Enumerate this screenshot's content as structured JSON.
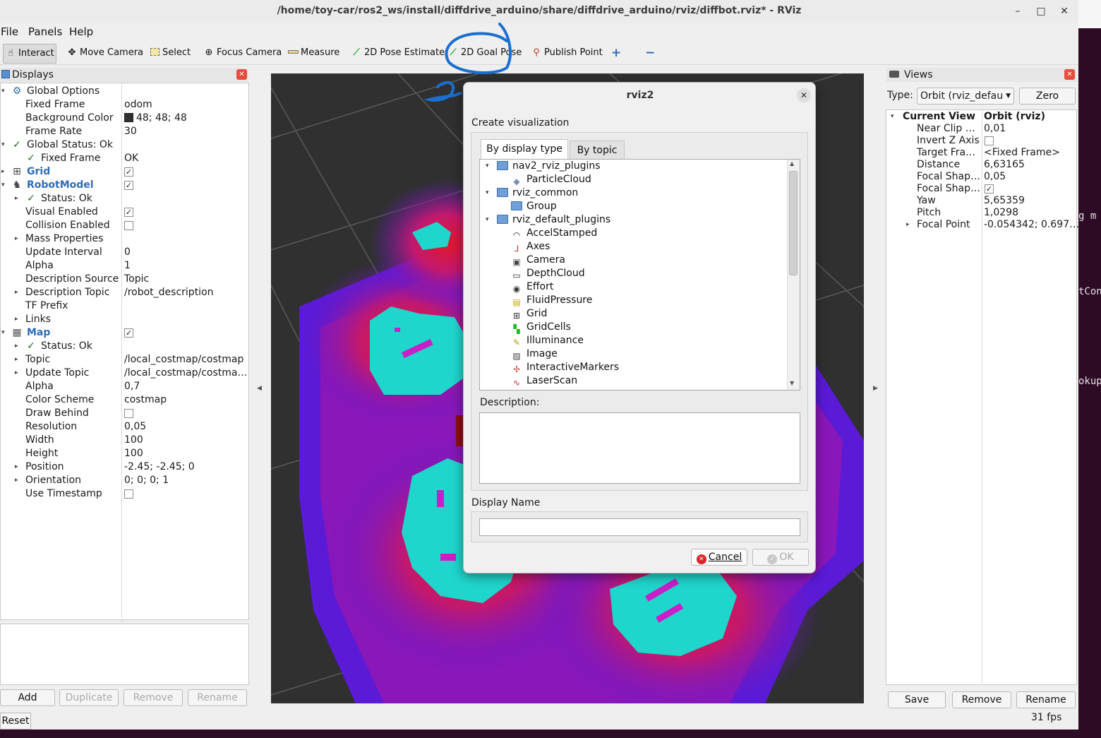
{
  "window": {
    "title": "/home/toy-car/ros2_ws/install/diffdrive_arduino/share/diffdrive_arduino/rviz/diffbot.rviz* - RViz",
    "minimize": "–",
    "maximize": "□",
    "close": "✕"
  },
  "menu": [
    "File",
    "Panels",
    "Help"
  ],
  "toolbar": {
    "interact": "Interact",
    "move_camera": "Move Camera",
    "select": "Select",
    "focus_camera": "Focus Camera",
    "measure": "Measure",
    "pose_estimate": "2D Pose Estimate",
    "goal_pose": "2D Goal Pose",
    "publish_point": "Publish Point",
    "add": "+",
    "remove": "−"
  },
  "displays": {
    "title": "Displays",
    "rows": [
      {
        "label": "Global Options",
        "value": ""
      },
      {
        "label": "Fixed Frame",
        "value": "odom"
      },
      {
        "label": "Background Color",
        "value": "48; 48; 48"
      },
      {
        "label": "Frame Rate",
        "value": "30"
      },
      {
        "label": "Global Status: Ok",
        "value": ""
      },
      {
        "label": "Fixed Frame",
        "value": "OK"
      },
      {
        "label": "Grid",
        "value": ""
      },
      {
        "label": "RobotModel",
        "value": ""
      },
      {
        "label": "Status: Ok",
        "value": ""
      },
      {
        "label": "Visual Enabled",
        "value": ""
      },
      {
        "label": "Collision Enabled",
        "value": ""
      },
      {
        "label": "Mass Properties",
        "value": ""
      },
      {
        "label": "Update Interval",
        "value": "0"
      },
      {
        "label": "Alpha",
        "value": "1"
      },
      {
        "label": "Description Source",
        "value": "Topic"
      },
      {
        "label": "Description Topic",
        "value": "/robot_description"
      },
      {
        "label": "TF Prefix",
        "value": ""
      },
      {
        "label": "Links",
        "value": ""
      },
      {
        "label": "Map",
        "value": ""
      },
      {
        "label": "Status: Ok",
        "value": ""
      },
      {
        "label": "Topic",
        "value": "/local_costmap/costmap"
      },
      {
        "label": "Update Topic",
        "value": "/local_costmap/costma…"
      },
      {
        "label": "Alpha",
        "value": "0,7"
      },
      {
        "label": "Color Scheme",
        "value": "costmap"
      },
      {
        "label": "Draw Behind",
        "value": ""
      },
      {
        "label": "Resolution",
        "value": "0,05"
      },
      {
        "label": "Width",
        "value": "100"
      },
      {
        "label": "Height",
        "value": "100"
      },
      {
        "label": "Position",
        "value": "-2.45; -2.45; 0"
      },
      {
        "label": "Orientation",
        "value": "0; 0; 0; 1"
      },
      {
        "label": "Use Timestamp",
        "value": ""
      }
    ],
    "buttons": {
      "add": "Add",
      "duplicate": "Duplicate",
      "remove": "Remove",
      "rename": "Rename"
    }
  },
  "views": {
    "title": "Views",
    "type_label": "Type:",
    "type_value": "Orbit (rviz_defau",
    "zero": "Zero",
    "rows": [
      {
        "label": "Current View",
        "value": "Orbit (rviz)"
      },
      {
        "label": "Near Clip …",
        "value": "0,01"
      },
      {
        "label": "Invert Z Axis",
        "value": ""
      },
      {
        "label": "Target Fra…",
        "value": "<Fixed Frame>"
      },
      {
        "label": "Distance",
        "value": "6,63165"
      },
      {
        "label": "Focal Shap…",
        "value": "0,05"
      },
      {
        "label": "Focal Shap…",
        "value": ""
      },
      {
        "label": "Yaw",
        "value": "5,65359"
      },
      {
        "label": "Pitch",
        "value": "1,0298"
      },
      {
        "label": "Focal Point",
        "value": "-0.054342; 0.697…"
      }
    ],
    "buttons": {
      "save": "Save",
      "remove": "Remove",
      "rename": "Rename"
    }
  },
  "status": {
    "reset": "Reset",
    "fps": "31 fps"
  },
  "dialog": {
    "title": "rviz2",
    "heading": "Create visualization",
    "tab_display_type": "By display type",
    "tab_topic": "By topic",
    "items": [
      {
        "label": "nav2_rviz_plugins",
        "kind": "folder",
        "icon": "folder-icon"
      },
      {
        "label": "ParticleCloud",
        "kind": "item",
        "icon": "diamond-icon"
      },
      {
        "label": "rviz_common",
        "kind": "folder",
        "icon": "folder-icon"
      },
      {
        "label": "Group",
        "kind": "item",
        "icon": "folder-icon"
      },
      {
        "label": "rviz_default_plugins",
        "kind": "folder",
        "icon": "folder-icon"
      },
      {
        "label": "AccelStamped",
        "kind": "item",
        "icon": "accel-icon"
      },
      {
        "label": "Axes",
        "kind": "item",
        "icon": "axes-icon"
      },
      {
        "label": "Camera",
        "kind": "item",
        "icon": "camera-icon"
      },
      {
        "label": "DepthCloud",
        "kind": "item",
        "icon": "depthcloud-icon"
      },
      {
        "label": "Effort",
        "kind": "item",
        "icon": "effort-icon"
      },
      {
        "label": "FluidPressure",
        "kind": "item",
        "icon": "fluidpressure-icon"
      },
      {
        "label": "Grid",
        "kind": "item",
        "icon": "grid-icon"
      },
      {
        "label": "GridCells",
        "kind": "item",
        "icon": "gridcells-icon"
      },
      {
        "label": "Illuminance",
        "kind": "item",
        "icon": "illuminance-icon"
      },
      {
        "label": "Image",
        "kind": "item",
        "icon": "image-icon"
      },
      {
        "label": "InteractiveMarkers",
        "kind": "item",
        "icon": "interactive-markers-icon"
      },
      {
        "label": "LaserScan",
        "kind": "item",
        "icon": "laserscan-icon"
      }
    ],
    "description_label": "Description:",
    "display_name_label": "Display Name",
    "display_name_value": "",
    "cancel": "Cancel",
    "ok": "OK"
  },
  "desktop_fragments": [
    "g m",
    "tCon",
    "okup"
  ],
  "colors": {
    "costmap_cyan": "#1fd6cc",
    "costmap_red": "#d81c2a",
    "costmap_purple": "#6b17d6",
    "annotation_blue": "#1a6fd0",
    "background": "#303030"
  }
}
